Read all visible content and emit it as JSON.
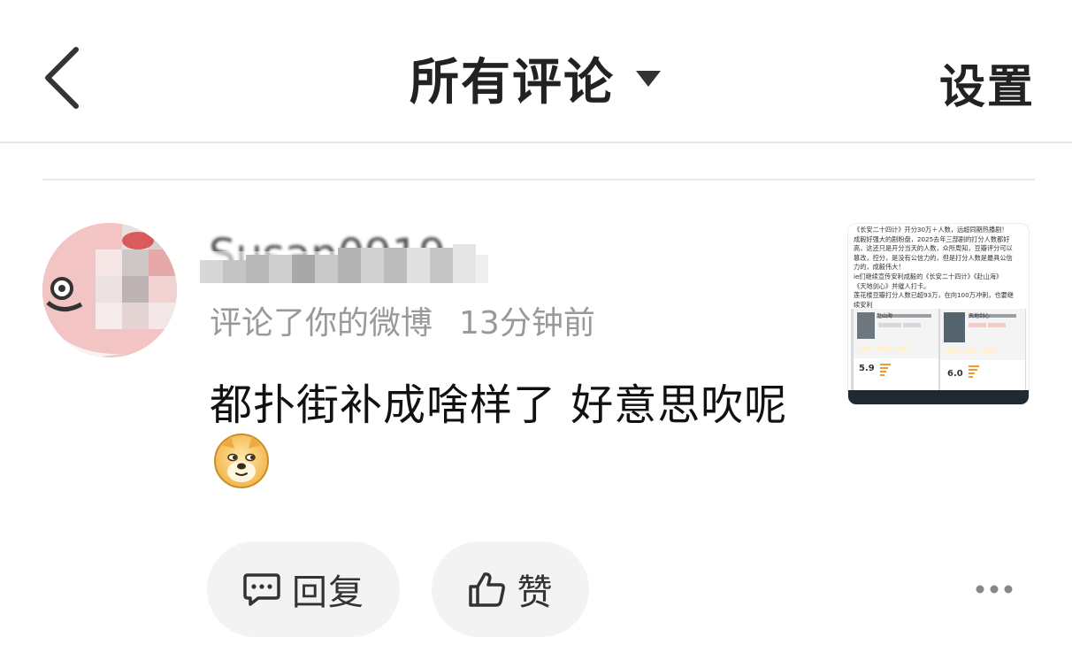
{
  "header": {
    "back_icon": "chevron-left-icon",
    "title": "所有评论",
    "title_caret_icon": "caret-down-icon",
    "settings_label": "设置"
  },
  "comment": {
    "username": "Susan0919",
    "action_text": "评论了你的微博",
    "time": "13分钟前",
    "text": "都扑街补成啥样了  好意思吹呢",
    "emoji": "doge-emoji-icon",
    "thumbnail": {
      "lines": [
        "《长安二十四计》开分30万＋人数，远超同期热播剧！",
        "成毅好强大的剧粉盘，2025去年三部剧的打分人数都好",
        "高，这还只是开分当天的人数，众所周知，豆瓣评分可以",
        "篡改，控分，是没有公信力的，但是打分人数是最具公信",
        "力的，成毅伟大！",
        "ie们继续宣传安利成毅的《长安二十四计》《赴山海》",
        "《天地剑心》并催人打卡。",
        "莲花楼豆瓣打分人数已超93万，在向100万冲刺，也要继",
        "续安利"
      ],
      "cards": [
        {
          "title": "赴山海",
          "score": "5.9"
        },
        {
          "title": "天地剑心",
          "score": "6.0"
        }
      ]
    }
  },
  "actions": {
    "reply_label": "回复",
    "reply_icon": "comment-bubble-icon",
    "like_label": "赞",
    "like_icon": "thumbs-up-icon",
    "more_icon": "more-dots-icon"
  },
  "colors": {
    "primary_text": "#222222",
    "secondary_text": "#999999",
    "pill_bg": "#f3f3f3",
    "divider": "#e8e8e8"
  }
}
